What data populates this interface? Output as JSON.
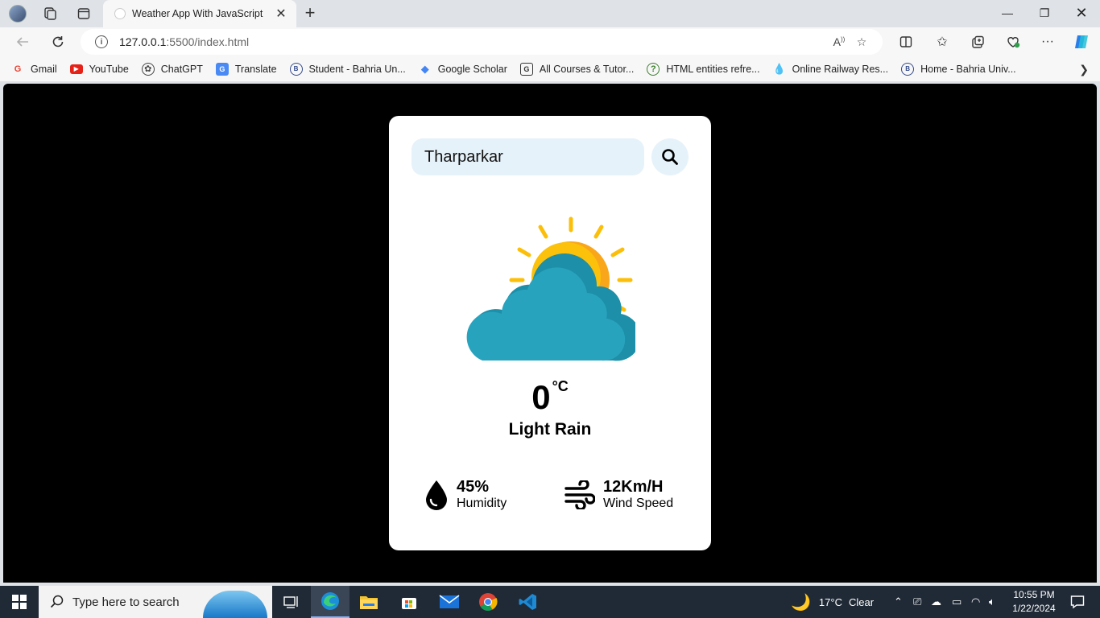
{
  "browser": {
    "tab_title": "Weather App With JavaScript",
    "url_host": "127.0.0.1",
    "url_rest": ":5500/index.html",
    "bookmarks": [
      {
        "label": "Gmail",
        "icon": "gmail-icon"
      },
      {
        "label": "YouTube",
        "icon": "youtube-icon"
      },
      {
        "label": "ChatGPT",
        "icon": "chatgpt-icon"
      },
      {
        "label": "Translate",
        "icon": "translate-icon"
      },
      {
        "label": "Student - Bahria Un...",
        "icon": "bahria-icon"
      },
      {
        "label": "Google Scholar",
        "icon": "scholar-icon"
      },
      {
        "label": "All Courses & Tutor...",
        "icon": "courses-icon"
      },
      {
        "label": "HTML entities refre...",
        "icon": "help-icon"
      },
      {
        "label": "Online Railway Res...",
        "icon": "railway-icon"
      },
      {
        "label": "Home - Bahria Univ...",
        "icon": "bahria-icon"
      }
    ]
  },
  "weather": {
    "city": "Tharparkar",
    "temperature": "0",
    "unit": "°C",
    "condition": "Light Rain",
    "humidity_value": "45%",
    "humidity_label": "Humidity",
    "wind_value": "12Km/H",
    "wind_label": "Wind Speed"
  },
  "taskbar": {
    "search_placeholder": "Type here to search",
    "weather_temp": "17°C",
    "weather_text": "Clear",
    "time": "10:55 PM",
    "date": "1/22/2024"
  },
  "colors": {
    "page_bg": "#000000",
    "card_bg": "#ffffff",
    "search_bg": "#e6f2fa",
    "sun": "#fbbf0a",
    "cloud": "#26a4bf"
  }
}
